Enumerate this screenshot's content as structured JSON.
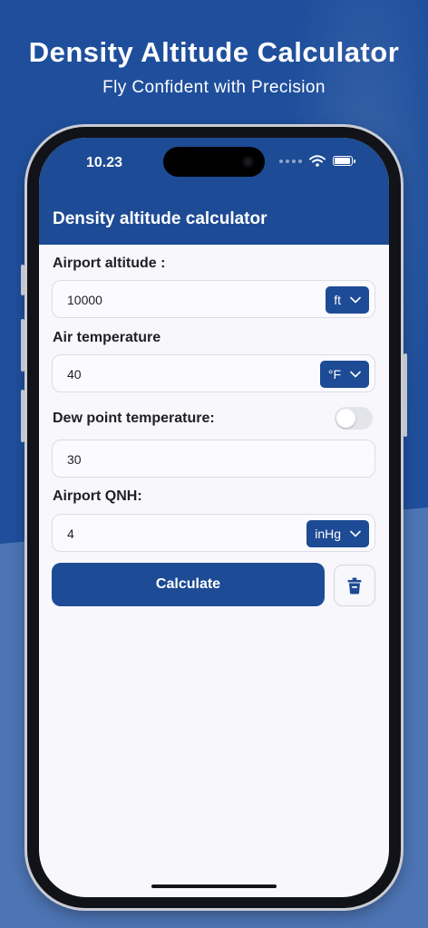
{
  "hero": {
    "title": "Density Altitude Calculator",
    "subtitle": "Fly Confident with Precision"
  },
  "status_bar": {
    "time": "10.23"
  },
  "app_bar": {
    "title": "Density altitude calculator"
  },
  "form": {
    "airport_altitude": {
      "label": "Airport altitude :",
      "value": "10000",
      "unit": "ft"
    },
    "air_temperature": {
      "label": "Air temperature",
      "value": "40",
      "unit": "°F"
    },
    "dew_point": {
      "label": "Dew point temperature:",
      "value": "30",
      "toggle_on": false
    },
    "qnh": {
      "label": "Airport QNH:",
      "value": "4",
      "unit": "inHg"
    }
  },
  "actions": {
    "calculate_label": "Calculate",
    "clear_icon": "trash-icon"
  },
  "colors": {
    "primary": "#1d4b95",
    "background": "#1f4f9c",
    "screen_background": "#f7f7fc"
  }
}
